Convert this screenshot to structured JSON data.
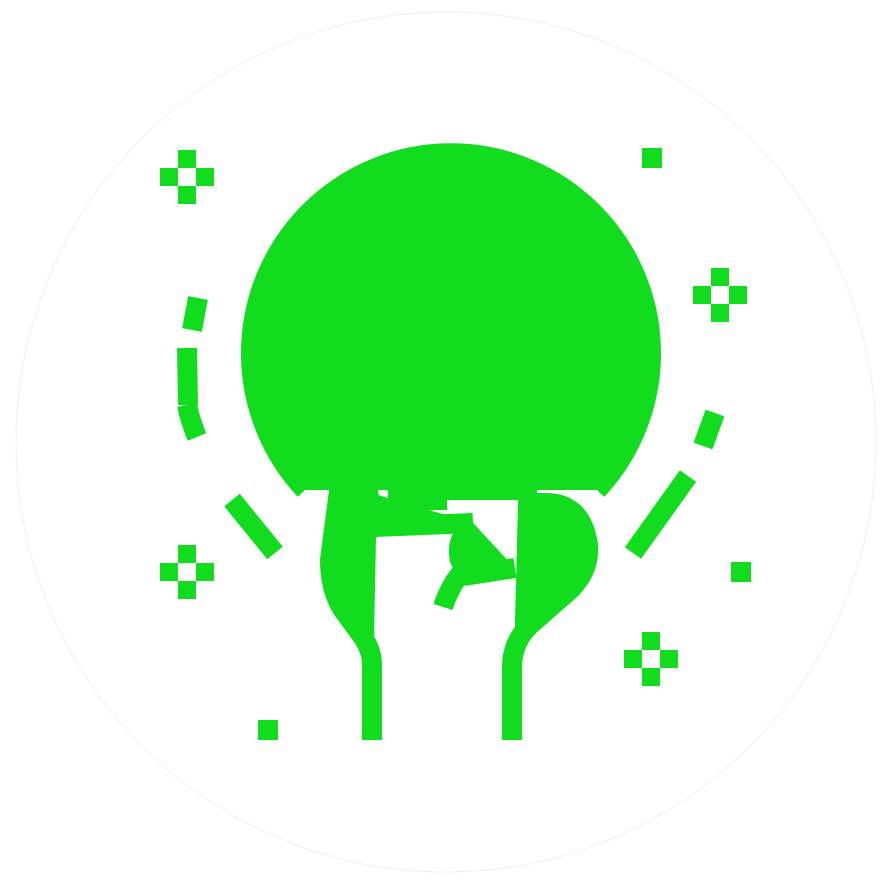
{
  "icon": {
    "name": "fist-holding-globe-icon",
    "stroke_color": "#12DC1E",
    "background_color": "#FFFFFF",
    "badge_color": "#FFFFFF"
  }
}
